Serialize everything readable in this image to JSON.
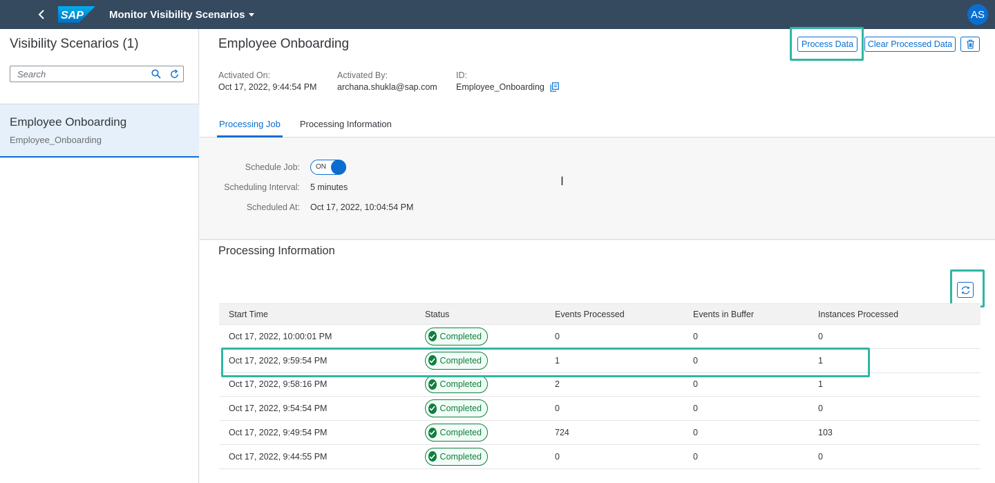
{
  "shell": {
    "logo": "SAP",
    "app_title": "Monitor Visibility Scenarios",
    "avatar_initials": "AS"
  },
  "master": {
    "title": "Visibility Scenarios (1)",
    "search_placeholder": "Search",
    "items": [
      {
        "title": "Employee Onboarding",
        "subtitle": "Employee_Onboarding"
      }
    ]
  },
  "detail": {
    "title": "Employee Onboarding",
    "buttons": {
      "process": "Process Data",
      "clear": "Clear Processed Data"
    },
    "attributes": {
      "activated_on_label": "Activated On:",
      "activated_on_value": "Oct 17, 2022, 9:44:54 PM",
      "activated_by_label": "Activated By:",
      "activated_by_value": "archana.shukla@sap.com",
      "id_label": "ID:",
      "id_value": "Employee_Onboarding"
    },
    "tabs": [
      {
        "label": "Processing Job",
        "active": true
      },
      {
        "label": "Processing Information",
        "active": false
      }
    ]
  },
  "job": {
    "schedule_label": "Schedule Job:",
    "schedule_state": "ON",
    "interval_label": "Scheduling Interval:",
    "interval_value": "5 minutes",
    "scheduled_at_label": "Scheduled At:",
    "scheduled_at_value": "Oct 17, 2022, 10:04:54 PM"
  },
  "processing": {
    "title": "Processing Information",
    "columns": [
      "Start Time",
      "Status",
      "Events Processed",
      "Events in Buffer",
      "Instances Processed"
    ],
    "rows": [
      {
        "start": "Oct 17, 2022, 10:00:01 PM",
        "status": "Completed",
        "events": "0",
        "buffer": "0",
        "instances": "0"
      },
      {
        "start": "Oct 17, 2022, 9:59:54 PM",
        "status": "Completed",
        "events": "1",
        "buffer": "0",
        "instances": "1"
      },
      {
        "start": "Oct 17, 2022, 9:58:16 PM",
        "status": "Completed",
        "events": "2",
        "buffer": "0",
        "instances": "1"
      },
      {
        "start": "Oct 17, 2022, 9:54:54 PM",
        "status": "Completed",
        "events": "0",
        "buffer": "0",
        "instances": "0"
      },
      {
        "start": "Oct 17, 2022, 9:49:54 PM",
        "status": "Completed",
        "events": "724",
        "buffer": "0",
        "instances": "103"
      },
      {
        "start": "Oct 17, 2022, 9:44:55 PM",
        "status": "Completed",
        "events": "0",
        "buffer": "0",
        "instances": "0"
      }
    ]
  },
  "colors": {
    "shell_bg": "#354a5f",
    "accent": "#0a6ed1",
    "success": "#107e3e",
    "highlight": "#2fb6a3"
  }
}
